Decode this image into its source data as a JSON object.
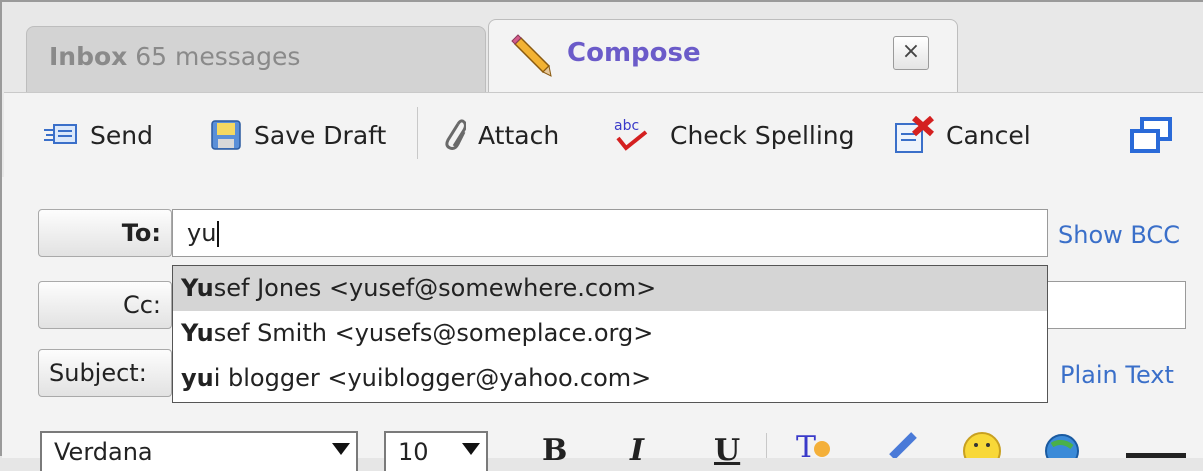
{
  "tabs": {
    "inbox": {
      "label": "Inbox",
      "count": "65 messages"
    },
    "compose": {
      "label": "Compose",
      "close": "×"
    }
  },
  "toolbar": {
    "send": "Send",
    "save_draft": "Save Draft",
    "attach": "Attach",
    "check_spelling": "Check Spelling",
    "cancel": "Cancel"
  },
  "fields": {
    "to_label": "To:",
    "to_value": "yu",
    "cc_label": "Cc:",
    "subject_label": "Subject:",
    "show_bcc": "Show BCC",
    "plain_text": "Plain Text"
  },
  "suggestions": [
    {
      "match": "Yu",
      "rest": "sef Jones <yusef@somewhere.com>",
      "selected": true
    },
    {
      "match": "Yu",
      "rest": "sef Smith <yusefs@someplace.org>",
      "selected": false
    },
    {
      "match": "yu",
      "rest": "i blogger <yuiblogger@yahoo.com>",
      "selected": false
    }
  ],
  "format_bar": {
    "font": "Verdana",
    "size": "10",
    "bold": "B",
    "italic": "I",
    "underline": "U"
  },
  "colors": {
    "accent": "#6b5bc9",
    "link": "#3a6fc9"
  }
}
